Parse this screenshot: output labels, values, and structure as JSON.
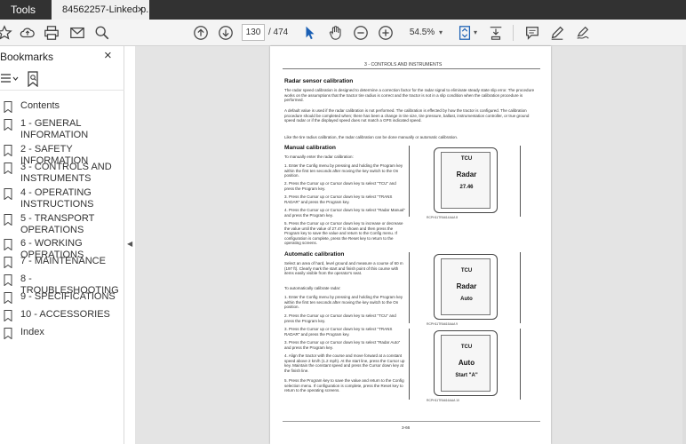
{
  "tabs": {
    "tools": "Tools",
    "document": "84562257-Linked p...",
    "close": "×"
  },
  "toolbar": {
    "current_page": "130",
    "page_separator": "/ 474",
    "zoom": "54.5%",
    "icons": [
      "star-icon",
      "cloud-upload-icon",
      "print-icon",
      "email-icon",
      "zoom-search-icon",
      "page-up-icon",
      "page-down-icon",
      "select-cursor-icon",
      "hand-tool-icon",
      "zoom-out-icon",
      "zoom-in-icon",
      "page-fit-icon",
      "scroll-mode-icon",
      "comment-icon",
      "pen-icon",
      "sign-icon"
    ]
  },
  "sidebar": {
    "title": "Bookmarks",
    "close": "×",
    "items": [
      {
        "label": "Contents"
      },
      {
        "label": "1 - GENERAL INFORMATION"
      },
      {
        "label": "2 - SAFETY INFORMATION"
      },
      {
        "label": "3 - CONTROLS AND INSTRUMENTS"
      },
      {
        "label": "4 - OPERATING INSTRUCTIONS"
      },
      {
        "label": "5 - TRANSPORT OPERATIONS"
      },
      {
        "label": "6 - WORKING OPERATIONS"
      },
      {
        "label": "7 - MAINTENANCE"
      },
      {
        "label": "8 - TROUBLESHOOTING"
      },
      {
        "label": "9 - SPECIFICATIONS"
      },
      {
        "label": "10 - ACCESSORIES"
      },
      {
        "label": "Index"
      }
    ]
  },
  "document": {
    "running_header": "3 - CONTROLS AND INSTRUMENTS",
    "section_title": "Radar sensor calibration",
    "intro_1": "The radar speed calibration is designed to determine a correction factor for the radar signal to eliminate steady state slip error. The procedure works on the assumptions that the tractor tire radius is correct and the tractor is not in a slip condition when the calibration procedure is performed.",
    "intro_2": "A default value is used if the radar calibration is not performed. The calibration is effected by how the tractor is configured. The calibration procedure should be completed when; there has been a change in tire size, tire pressure, ballast, instrumentation controller, or true ground speed radar or if the displayed speed does not match a GPS indicated speed.",
    "intro_3": "Like the tire radius calibration, the radar calibration can be done manually or automatic calibration.",
    "manual_title": "Manual calibration",
    "manual_lead": "To manually enter the radar calibration:",
    "manual_steps": [
      "1. Enter the Config menu by pressing and holding the Program key within the first ten seconds after moving the key switch to the On position.",
      "2. Press the Cursor up or Cursor down key to select \"TCU\" and press the Program key.",
      "3. Press the Cursor up or Cursor down key to select \"TRANS RADAR\" and press the Program key.",
      "4. Press the Cursor up or Cursor down key to select \"Radar Manual\" and press the Program key.",
      "5. Press the Cursor up or Cursor down key to increase or decrease the value until the value of 27.47 is shown and then press the Program key to save the value and return to the Config menu. If configuration is complete, press the Reset key to return to the operating screens."
    ],
    "auto_title": "Automatic calibration",
    "auto_intro": "Select an area of hard, level ground and measure a course of 60 m (197 ft). Clearly mark the start and finish point of this course with items easily visible from the operator's seat.",
    "auto_lead": "To automatically calibrate radar:",
    "auto_steps": [
      "1. Enter the Config menu by pressing and holding the Program key within the first ten seconds after moving the key switch to the On position.",
      "2. Press the Cursor up or Cursor down key to select \"TCU\" and press the Program key.",
      "3. Press the Cursor up or Cursor down key to select \"TRANS RADAR\" and press the Program key.",
      "3. Press the Cursor up or Cursor down key to select \"Radar Auto\" and press the Program key.",
      "4. Align the tractor with the course and move forward at a constant speed above 2 km/h (1.2 mph). At the start line, press the Cursor up key. Maintain the constant speed and press the Cursor down key at the finish line.",
      "5. Press the Program key to save the value and return to the Config selection menu. If configuration is complete, press the Reset key to return to the operating screens."
    ],
    "figures": [
      {
        "lines": [
          "TCU",
          "Radar",
          "27.46"
        ],
        "caption": "RCPH11TRA614AAA   8"
      },
      {
        "lines": [
          "TCU",
          "Radar",
          "Auto"
        ],
        "caption": "RCPH11TRA615AAA   9"
      },
      {
        "lines": [
          "TCU",
          "Auto",
          "Start \"A\""
        ],
        "caption": "RCPH11TRA616AAA   10"
      }
    ],
    "page_number": "3-66"
  }
}
